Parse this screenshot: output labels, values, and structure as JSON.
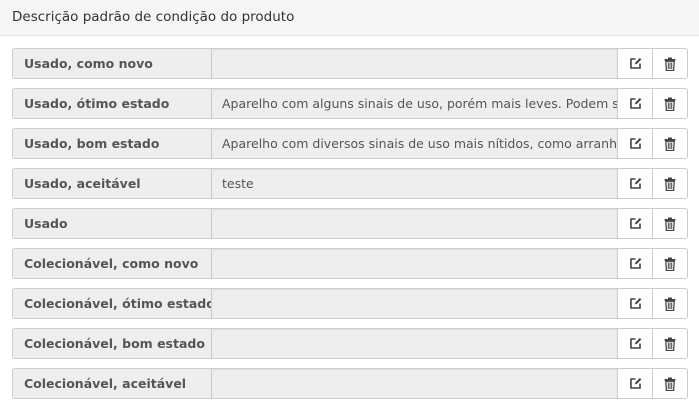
{
  "header": {
    "title": "Descrição padrão de condição do produto"
  },
  "icons": {
    "edit": "edit-icon",
    "delete": "trash-icon"
  },
  "conditions": [
    {
      "label": "Usado, como novo",
      "value": ""
    },
    {
      "label": "Usado, ótimo estado",
      "value": "Aparelho com alguns sinais de uso, porém mais leves. Podem ser"
    },
    {
      "label": "Usado, bom estado",
      "value": "Aparelho com diversos sinais de uso mais nítidos, como arranhõe"
    },
    {
      "label": "Usado, aceitável",
      "value": "teste"
    },
    {
      "label": "Usado",
      "value": ""
    },
    {
      "label": "Colecionável, como novo",
      "value": ""
    },
    {
      "label": "Colecionável, ótimo estado",
      "value": ""
    },
    {
      "label": "Colecionável, bom estado",
      "value": ""
    },
    {
      "label": "Colecionável, aceitável",
      "value": ""
    }
  ]
}
